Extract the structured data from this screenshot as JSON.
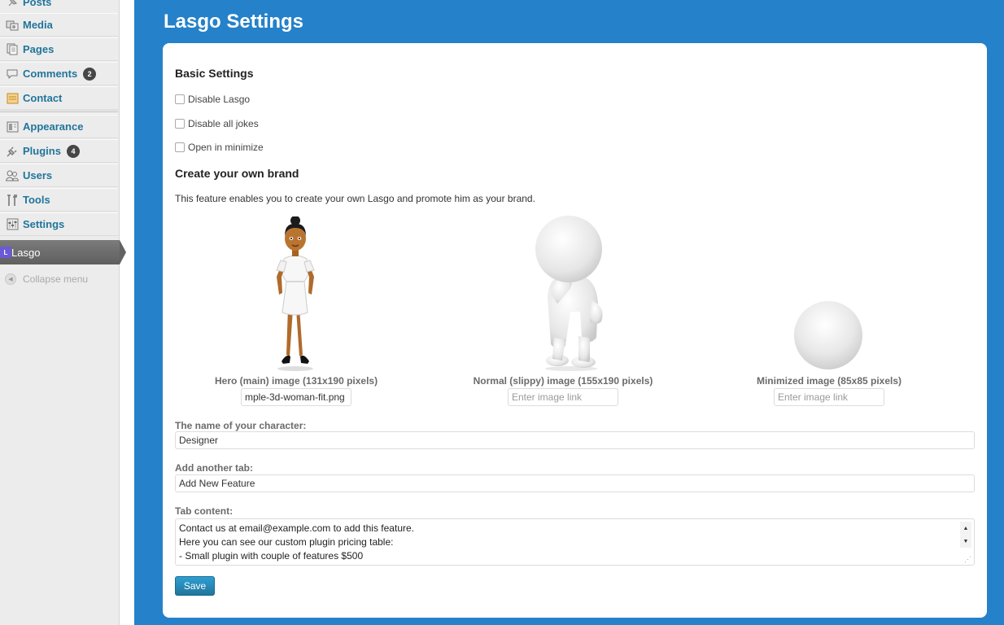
{
  "sidebar": {
    "items": [
      {
        "label": "Posts",
        "icon": "pushpin-icon"
      },
      {
        "label": "Media",
        "icon": "media-icon"
      },
      {
        "label": "Pages",
        "icon": "pages-icon"
      },
      {
        "label": "Comments",
        "icon": "comment-icon",
        "badge": "2"
      },
      {
        "label": "Contact",
        "icon": "contact-icon"
      },
      {
        "label": "Appearance",
        "icon": "appearance-icon"
      },
      {
        "label": "Plugins",
        "icon": "plugin-icon",
        "badge": "4"
      },
      {
        "label": "Users",
        "icon": "users-icon"
      },
      {
        "label": "Tools",
        "icon": "tools-icon"
      },
      {
        "label": "Settings",
        "icon": "settings-icon"
      }
    ],
    "active": {
      "label": "Lasgo",
      "icon_letter": "L"
    },
    "collapse_label": "Collapse menu"
  },
  "page": {
    "title": "Lasgo Settings"
  },
  "basic": {
    "heading": "Basic Settings",
    "checkboxes": [
      {
        "label": "Disable Lasgo",
        "checked": false
      },
      {
        "label": "Disable all jokes",
        "checked": false
      },
      {
        "label": "Open in minimize",
        "checked": false
      }
    ]
  },
  "brand": {
    "heading": "Create your own brand",
    "description": "This feature enables you to create your own Lasgo and promote him as your brand.",
    "images": [
      {
        "label": "Hero (main) image (131x190 pixels)",
        "value": "mple-3d-woman-fit.png",
        "placeholder": ""
      },
      {
        "label": "Normal (slippy) image (155x190 pixels)",
        "value": "",
        "placeholder": "Enter image link"
      },
      {
        "label": "Minimized image (85x85 pixels)",
        "value": "",
        "placeholder": "Enter image link"
      }
    ]
  },
  "fields": {
    "character_name_label": "The name of your character:",
    "character_name_value": "Designer",
    "another_tab_label": "Add another tab:",
    "another_tab_value": "Add New Feature",
    "tab_content_label": "Tab content:",
    "tab_content_lines": [
      "Contact us at email@example.com to add this feature.",
      "Here you can see our custom plugin pricing table:",
      "- Small plugin with couple of features $500"
    ]
  },
  "save_label": "Save",
  "colors": {
    "accent": "#2581c9",
    "link": "#21759b",
    "sidebar_bg": "#ececec"
  }
}
